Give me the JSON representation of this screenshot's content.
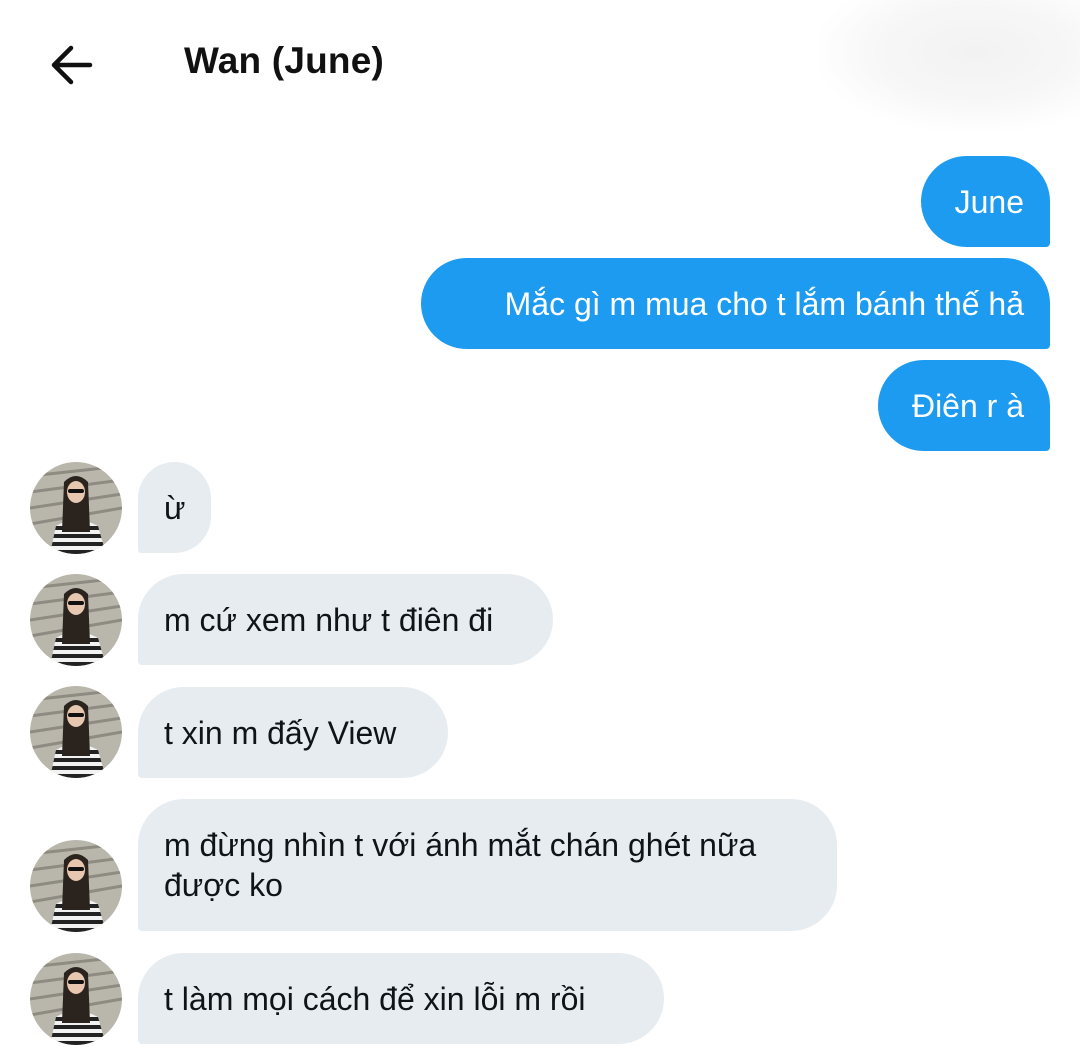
{
  "header": {
    "title": "Wan (June)",
    "back_icon": "arrow-left-icon"
  },
  "colors": {
    "outgoing_bubble": "#1d9bf0",
    "incoming_bubble": "#e7ecf0",
    "outgoing_text": "#ffffff",
    "incoming_text": "#0f1419"
  },
  "messages": [
    {
      "direction": "outgoing",
      "text": "June"
    },
    {
      "direction": "outgoing",
      "text": "Mắc gì m mua cho t lắm bánh thế hả"
    },
    {
      "direction": "outgoing",
      "text": "Điên r à"
    },
    {
      "direction": "incoming",
      "text": "ừ"
    },
    {
      "direction": "incoming",
      "text": "m cứ xem như t điên đi"
    },
    {
      "direction": "incoming",
      "text": "t xin m đấy View"
    },
    {
      "direction": "incoming",
      "text": "m đừng nhìn t với ánh mắt chán ghét nữa được ko"
    },
    {
      "direction": "incoming",
      "text": "t làm mọi cách để xin lỗi m rồi"
    }
  ]
}
